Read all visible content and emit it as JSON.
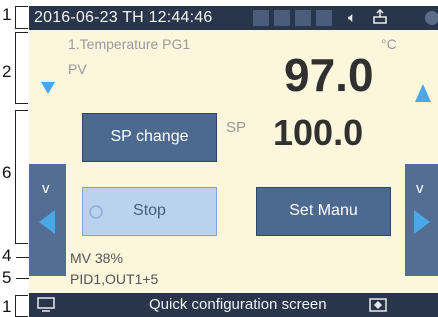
{
  "status_bar": {
    "datetime": "2016-06-23 TH 12:44:46",
    "speaker_icon": "speaker-icon",
    "usb_icon": "usb-icon"
  },
  "measurement": {
    "title": "1.Temperature PG1",
    "unit": "°C",
    "pv_label": "PV",
    "pv_value": "97.0",
    "sp_label": "SP",
    "sp_value": "100.0"
  },
  "buttons": {
    "sp_change": "SP change",
    "stop": "Stop",
    "set_manu": "Set Manu"
  },
  "info": {
    "mv": "MV 38%",
    "pid": "PID1,OUT1+5"
  },
  "nav": {
    "left_v": "v",
    "right_v": "v"
  },
  "bottom_bar": {
    "text": "Quick configuration screen"
  },
  "callouts": [
    "1",
    "2",
    "6",
    "4",
    "5",
    "1"
  ],
  "colors": {
    "bar_bg": "#29354a",
    "screen_bg": "#fbf6dc",
    "button_dark": "#4c6a8f",
    "button_light": "#b9d3ef",
    "accent_arrow": "#4aa8e8"
  }
}
